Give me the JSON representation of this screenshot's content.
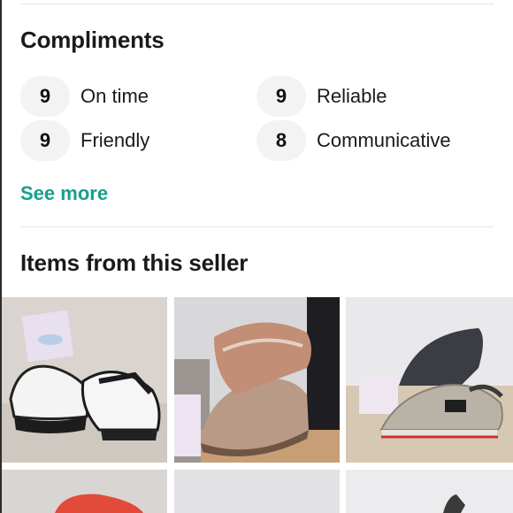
{
  "compliments": {
    "title": "Compliments",
    "items": [
      {
        "count": "9",
        "label": "On time"
      },
      {
        "count": "9",
        "label": "Reliable"
      },
      {
        "count": "9",
        "label": "Friendly"
      },
      {
        "count": "8",
        "label": "Communicative"
      }
    ],
    "see_more": "See more"
  },
  "items_section": {
    "title": "Items from this seller",
    "listings": [
      {
        "icon": "white-black-sneaker-photo"
      },
      {
        "icon": "tan-knit-sneaker-photo"
      },
      {
        "icon": "grey-retro-runner-photo"
      },
      {
        "icon": "red-sole-sneaker-photo"
      },
      {
        "icon": "sneaker-photo"
      },
      {
        "icon": "sneaker-photo"
      }
    ]
  },
  "colors": {
    "accent": "#15a08a",
    "chip": "#f3f3f3"
  }
}
